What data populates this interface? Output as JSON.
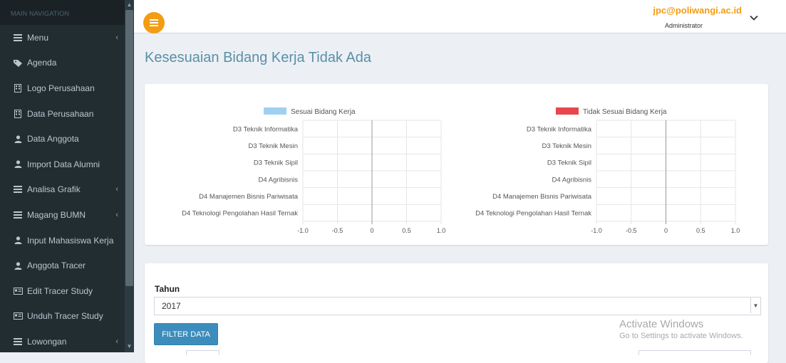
{
  "sidebar": {
    "header": "MAIN NAVIGATION",
    "items": [
      {
        "label": "Menu",
        "icon": "bars-icon",
        "chevron": true
      },
      {
        "label": "Agenda",
        "icon": "tag-icon",
        "chevron": false
      },
      {
        "label": "Logo Perusahaan",
        "icon": "building-icon",
        "chevron": false
      },
      {
        "label": "Data Perusahaan",
        "icon": "building-icon",
        "chevron": false
      },
      {
        "label": "Data Anggota",
        "icon": "user-icon",
        "chevron": false
      },
      {
        "label": "Import Data Alumni",
        "icon": "user-icon",
        "chevron": false
      },
      {
        "label": "Analisa Grafik",
        "icon": "bars-icon",
        "chevron": true
      },
      {
        "label": "Magang BUMN",
        "icon": "bars-icon",
        "chevron": true
      },
      {
        "label": "Input Mahasiswa Kerja",
        "icon": "user-icon",
        "chevron": false
      },
      {
        "label": "Anggota Tracer",
        "icon": "user-icon",
        "chevron": false
      },
      {
        "label": "Edit Tracer Study",
        "icon": "card-icon",
        "chevron": false
      },
      {
        "label": "Unduh Tracer Study",
        "icon": "card-icon",
        "chevron": false
      },
      {
        "label": "Lowongan",
        "icon": "bars-icon",
        "chevron": true
      }
    ]
  },
  "header": {
    "user_email": "jpc@poliwangi.ac.id",
    "user_role": "Administrator"
  },
  "page": {
    "title": "Kesesuaian Bidang Kerja Tidak Ada"
  },
  "chart_data": [
    {
      "type": "bar",
      "orientation": "horizontal",
      "categories": [
        "D3 Teknik Informatika",
        "D3 Teknik Mesin",
        "D3 Teknik Sipil",
        "D4 Agribisnis",
        "D4 Manajemen Bisnis Pariwisata",
        "D4 Teknologi Pengolahan Hasil Ternak"
      ],
      "series": [
        {
          "name": "Sesuai Bidang Kerja",
          "values": [
            0,
            0,
            0,
            0,
            0,
            0
          ],
          "color": "#a0d0f0"
        }
      ],
      "xlim": [
        -1.0,
        1.0
      ],
      "xticks": [
        "-1.0",
        "-0.5",
        "0",
        "0.5",
        "1.0"
      ],
      "grid": true,
      "legend": "top"
    },
    {
      "type": "bar",
      "orientation": "horizontal",
      "categories": [
        "D3 Teknik Informatika",
        "D3 Teknik Mesin",
        "D3 Teknik Sipil",
        "D4 Agribisnis",
        "D4 Manajemen Bisnis Pariwisata",
        "D4 Teknologi Pengolahan Hasil Ternak"
      ],
      "series": [
        {
          "name": "Tidak Sesuai Bidang Kerja",
          "values": [
            0,
            0,
            0,
            0,
            0,
            0
          ],
          "color": "#e8474b"
        }
      ],
      "xlim": [
        -1.0,
        1.0
      ],
      "xticks": [
        "-1.0",
        "-0.5",
        "0",
        "0.5",
        "1.0"
      ],
      "grid": true,
      "legend": "top"
    }
  ],
  "filter": {
    "label": "Tahun",
    "selected": "2017",
    "button_label": "FILTER DATA"
  },
  "watermark": {
    "line1": "Activate Windows",
    "line2": "Go to Settings to activate Windows."
  },
  "colors": {
    "sidebar_bg": "#222d32",
    "accent_orange": "#f39c12",
    "title_color": "#5a8fa6",
    "button_blue": "#3c8dbc"
  }
}
